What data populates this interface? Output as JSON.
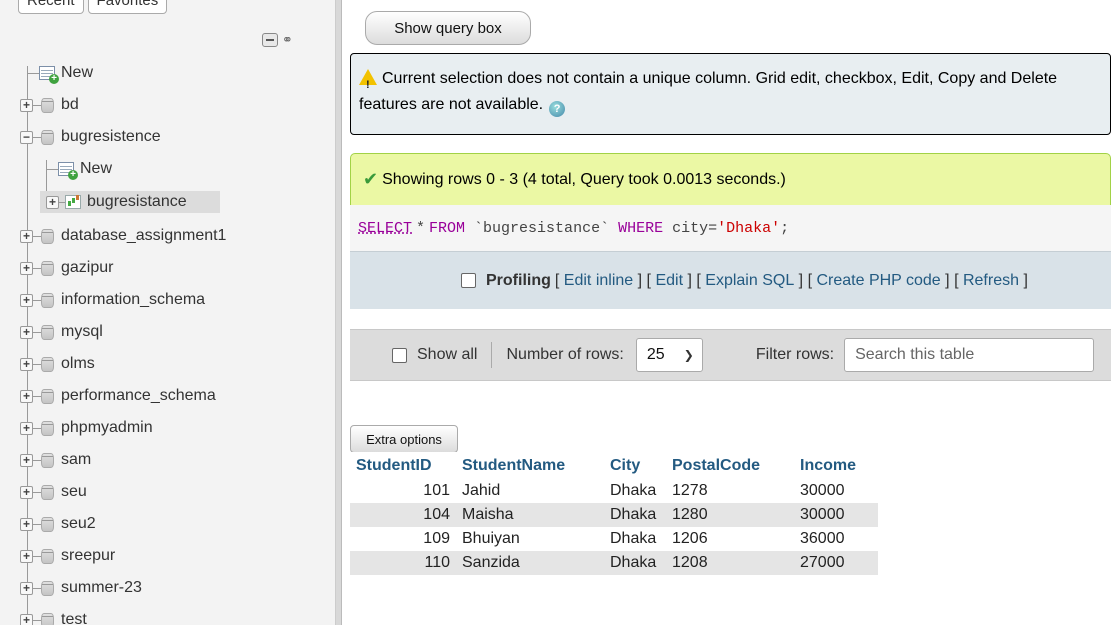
{
  "sidebar": {
    "top_tabs": [
      "Recent",
      "Favorites"
    ],
    "tree": [
      {
        "label": "New",
        "kind": "new",
        "level": 0
      },
      {
        "label": "bd",
        "kind": "db",
        "level": 0
      },
      {
        "label": "bugresistence",
        "kind": "db",
        "level": 0,
        "expanded": true
      },
      {
        "label": "New",
        "kind": "new",
        "level": 1
      },
      {
        "label": "bugresistance",
        "kind": "view",
        "level": 1,
        "active": true
      },
      {
        "label": "database_assignment1",
        "kind": "db",
        "level": 0
      },
      {
        "label": "gazipur",
        "kind": "db",
        "level": 0
      },
      {
        "label": "information_schema",
        "kind": "db",
        "level": 0
      },
      {
        "label": "mysql",
        "kind": "db",
        "level": 0
      },
      {
        "label": "olms",
        "kind": "db",
        "level": 0
      },
      {
        "label": "performance_schema",
        "kind": "db",
        "level": 0
      },
      {
        "label": "phpmyadmin",
        "kind": "db",
        "level": 0
      },
      {
        "label": "sam",
        "kind": "db",
        "level": 0
      },
      {
        "label": "seu",
        "kind": "db",
        "level": 0
      },
      {
        "label": "seu2",
        "kind": "db",
        "level": 0
      },
      {
        "label": "sreepur",
        "kind": "db",
        "level": 0
      },
      {
        "label": "summer-23",
        "kind": "db",
        "level": 0
      },
      {
        "label": "test",
        "kind": "db",
        "level": 0
      }
    ]
  },
  "main": {
    "show_query_label": "Show query box",
    "notice_text": "Current selection does not contain a unique column. Grid edit, checkbox, Edit, Copy and Delete features are not available.",
    "success_text": "Showing rows 0 - 3 (4 total, Query took 0.0013 seconds.)",
    "sql": {
      "select": "SELECT",
      "star": "*",
      "from": "FROM",
      "table": "`bugresistance`",
      "where": "WHERE",
      "cond": "city=",
      "value": "'Dhaka'",
      "end": ";"
    },
    "profiling": {
      "label": "Profiling",
      "links": [
        "Edit inline",
        "Edit",
        "Explain SQL",
        "Create PHP code",
        "Refresh"
      ]
    },
    "nav": {
      "show_all": "Show all",
      "rows_label": "Number of rows:",
      "rows_value": "25",
      "filter_label": "Filter rows:",
      "search_placeholder": "Search this table"
    },
    "extra_options_label": "Extra options",
    "table": {
      "columns": [
        "StudentID",
        "StudentName",
        "City",
        "PostalCode",
        "Income"
      ],
      "rows": [
        [
          "101",
          "Jahid",
          "Dhaka",
          "1278",
          "30000"
        ],
        [
          "104",
          "Maisha",
          "Dhaka",
          "1280",
          "30000"
        ],
        [
          "109",
          "Bhuiyan",
          "Dhaka",
          "1206",
          "36000"
        ],
        [
          "110",
          "Sanzida",
          "Dhaka",
          "1208",
          "27000"
        ]
      ]
    }
  }
}
